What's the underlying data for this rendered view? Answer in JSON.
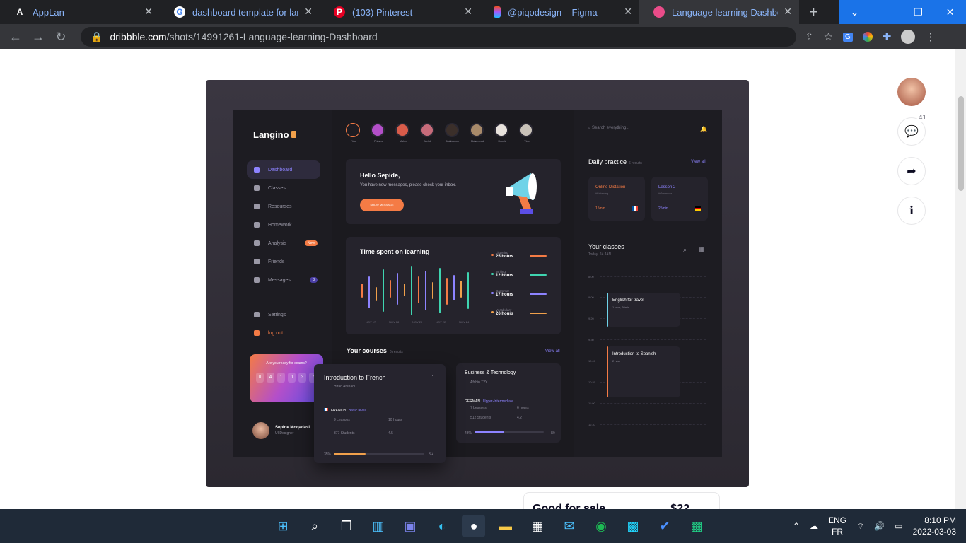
{
  "browser": {
    "tabs": [
      {
        "title": "AppLan",
        "icon": "applan-icon",
        "active": false
      },
      {
        "title": "dashboard template for langua",
        "icon": "google-icon",
        "active": false
      },
      {
        "title": "(103) Pinterest",
        "icon": "pinterest-icon",
        "active": false
      },
      {
        "title": "@piqodesign – Figma",
        "icon": "figma-icon",
        "active": false
      },
      {
        "title": "Language learning Dashboard",
        "icon": "dribbble-icon",
        "active": true
      }
    ],
    "url_host": "dribbble.com",
    "url_path": "/shots/14991261-Language-learning-Dashboard"
  },
  "shot": {
    "app_name": "Langino",
    "menu": [
      "Dashboard",
      "Classes",
      "Resourses",
      "Homework",
      "Analysis",
      "Friends",
      "Messages"
    ],
    "analysis_badge": "New",
    "messages_badge": "3",
    "settings": "Settings",
    "logout": "log out",
    "promo": {
      "question": "Are you ready for exams?",
      "digits": [
        "0",
        "4",
        "1",
        "0",
        "3",
        "7"
      ]
    },
    "user": {
      "name": "Sepide Moqadasi",
      "role": "UI Designer"
    },
    "friends": [
      "You",
      "Prinses",
      "Mahin",
      "Mehdi",
      "Mahboobeh",
      "Mohammad",
      "Hooshi",
      "Vida"
    ],
    "hello": {
      "title": "Hello Sepide,",
      "line": "You have new messages, please check your inbox.",
      "button": "SHOW MESSAGE"
    },
    "time": {
      "title": "Time spent on learning",
      "stats": [
        {
          "label": "Listening",
          "value": "25 hours",
          "color": "#f47b45"
        },
        {
          "label": "Writing",
          "value": "12 hours",
          "color": "#3fd4b0"
        },
        {
          "label": "Grammar",
          "value": "17 hours",
          "color": "#8d83ff"
        },
        {
          "label": "Vocabulary",
          "value": "26 hours",
          "color": "#f0a04b"
        }
      ],
      "days": [
        "NOV 17",
        "NOV 18",
        "NOV 20",
        "NOV 22",
        "NOV 24"
      ]
    },
    "courses": {
      "title": "Your courses",
      "count": "6 results",
      "viewall": "View all",
      "c1": {
        "title": "Introduction to French",
        "author": "Hirad Arshadi",
        "lang": "FRENCH",
        "level": "Basic level",
        "lessons": "9 Lessons",
        "hours": "10 hours",
        "students": "377 Students",
        "rating": "4.5",
        "from": "35%",
        "to": "3/+"
      },
      "c2": {
        "title": "Business & Technology",
        "author": "Afshin T2Y",
        "lang": "GERMAN",
        "level": "Upper-Intermediate",
        "lessons": "7 Lessons",
        "hours": "6 hours",
        "students": "512 Students",
        "rating": "4.2",
        "from": "43%",
        "to": "8/+"
      }
    },
    "search": "Search everything...",
    "daily": {
      "title": "Daily practice",
      "count": "6 results",
      "viewall": "View all",
      "p1": {
        "title": "Online Dictation",
        "sub": "#Listening",
        "dur": "15min"
      },
      "p2": {
        "title": "Lesson 2",
        "sub": "#Grammar",
        "dur": "25min"
      }
    },
    "classes": {
      "title": "Your classes",
      "date": "Today, 24 JAN",
      "hours": [
        "8:00",
        "9:00",
        "9:20",
        "9:30",
        "10:00",
        "10:30",
        "11:00",
        "11:30"
      ],
      "e1": {
        "title": "English for travel",
        "dur": "1 hour, 30min"
      },
      "e2": {
        "title": "Introduction to Spanish",
        "dur": "2 hour"
      }
    }
  },
  "dribbble": {
    "comments": "41",
    "sale_label": "Good for sale",
    "price": "$22"
  },
  "taskbar": {
    "lang1": "ENG",
    "lang2": "FR",
    "time": "8:10 PM",
    "date": "2022-03-03"
  }
}
